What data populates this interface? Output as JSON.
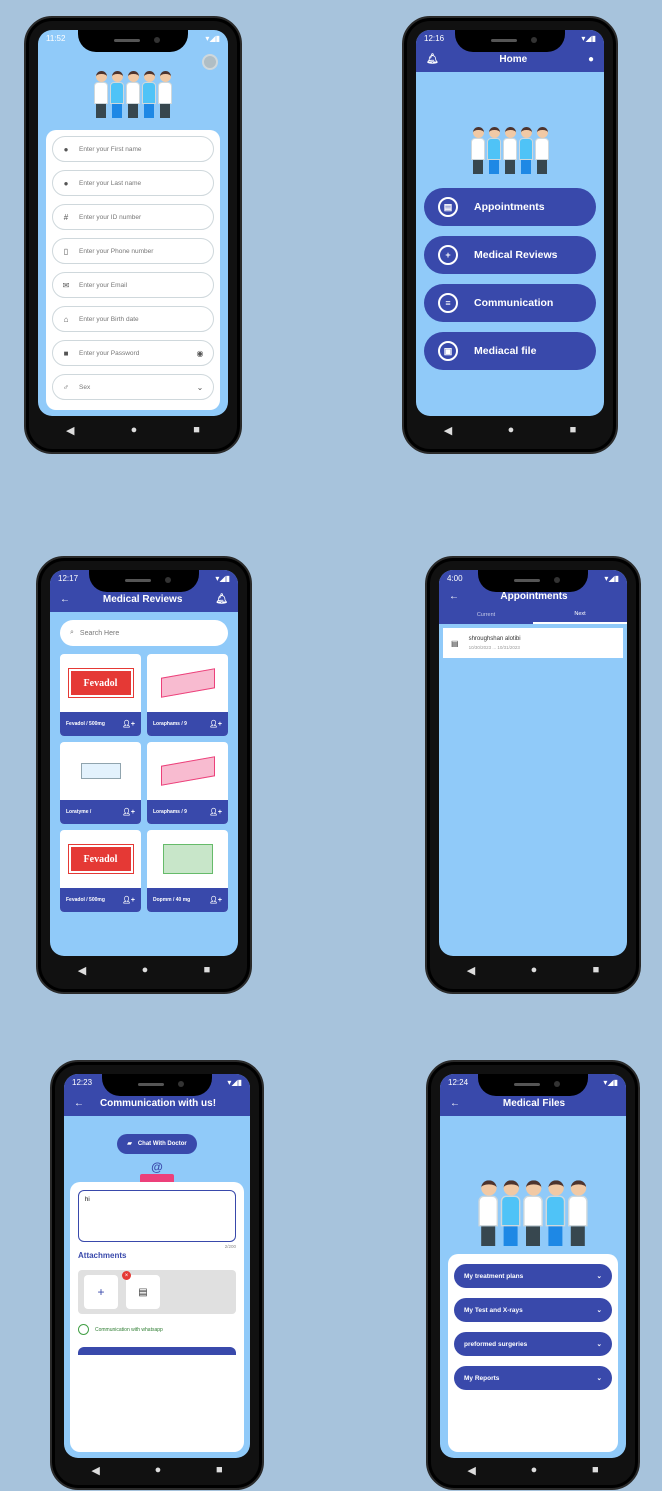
{
  "register": {
    "status_time": "11:52",
    "fields": [
      {
        "icon": "person-icon",
        "glyph": "●",
        "placeholder": "Enter your First name"
      },
      {
        "icon": "person-icon",
        "glyph": "●",
        "placeholder": "Enter your Last name"
      },
      {
        "icon": "hash-icon",
        "glyph": "#",
        "placeholder": "Enter your ID number"
      },
      {
        "icon": "phone-icon",
        "glyph": "▯",
        "placeholder": "Enter your Phone number"
      },
      {
        "icon": "mail-icon",
        "glyph": "✉",
        "placeholder": "Enter your Email"
      },
      {
        "icon": "cake-icon",
        "glyph": "⌂",
        "placeholder": "Enter your Birth date"
      },
      {
        "icon": "lock-icon",
        "glyph": "■",
        "placeholder": "Enter your Password"
      },
      {
        "icon": "gender-icon",
        "glyph": "♂",
        "placeholder": "Sex"
      }
    ]
  },
  "home": {
    "status_time": "12:16",
    "title": "Home",
    "menu": [
      {
        "icon": "calendar-icon",
        "glyph": "▤",
        "label": "Appointments"
      },
      {
        "icon": "medical-kit-icon",
        "glyph": "+",
        "label": "Medical Reviews"
      },
      {
        "icon": "chat-icon",
        "glyph": "≡",
        "label": "Communication"
      },
      {
        "icon": "file-icon",
        "glyph": "▣",
        "label": "Mediacal file"
      }
    ]
  },
  "reviews": {
    "status_time": "12:17",
    "title": "Medical Reviews",
    "search_placeholder": "Search Here",
    "brand": "Fevadol",
    "items": [
      {
        "label": "Fevadol / 500mg",
        "box": "red"
      },
      {
        "label": "Loraphams / 9",
        "box": "pink"
      },
      {
        "label": "Loratyme /",
        "box": "blue"
      },
      {
        "label": "Loraphams / 9",
        "box": "pink"
      },
      {
        "label": "Fevadol / 500mg",
        "box": "red"
      },
      {
        "label": "Dopmm / 40 mg",
        "box": "green"
      }
    ]
  },
  "appointments": {
    "status_time": "4:00",
    "title": "Appointments",
    "tabs": [
      "Current",
      "Next"
    ],
    "entry_name": "shroughshan alotibi",
    "entry_dates": "10/30/2023 ... 10/31/2023"
  },
  "communication": {
    "status_time": "12:23",
    "title": "Communication with us!",
    "chat_button": "Chat With Doctor",
    "at_symbol": "@",
    "message": "hi",
    "counter": "2/200",
    "attachments_label": "Attachments",
    "add_glyph": "+",
    "whatsapp_label": "Communication with whatsapp"
  },
  "files": {
    "status_time": "12:24",
    "title": "Medical Files",
    "items": [
      "My treatment plans",
      "My Test and X-rays",
      "preformed surgeries",
      "My Reports"
    ]
  },
  "colors": {
    "primary": "#3949ab",
    "screen_bg": "#90caf9",
    "page_bg": "#a7c3dc"
  },
  "nav": {
    "back": "◀",
    "home": "●",
    "recent": "■"
  }
}
